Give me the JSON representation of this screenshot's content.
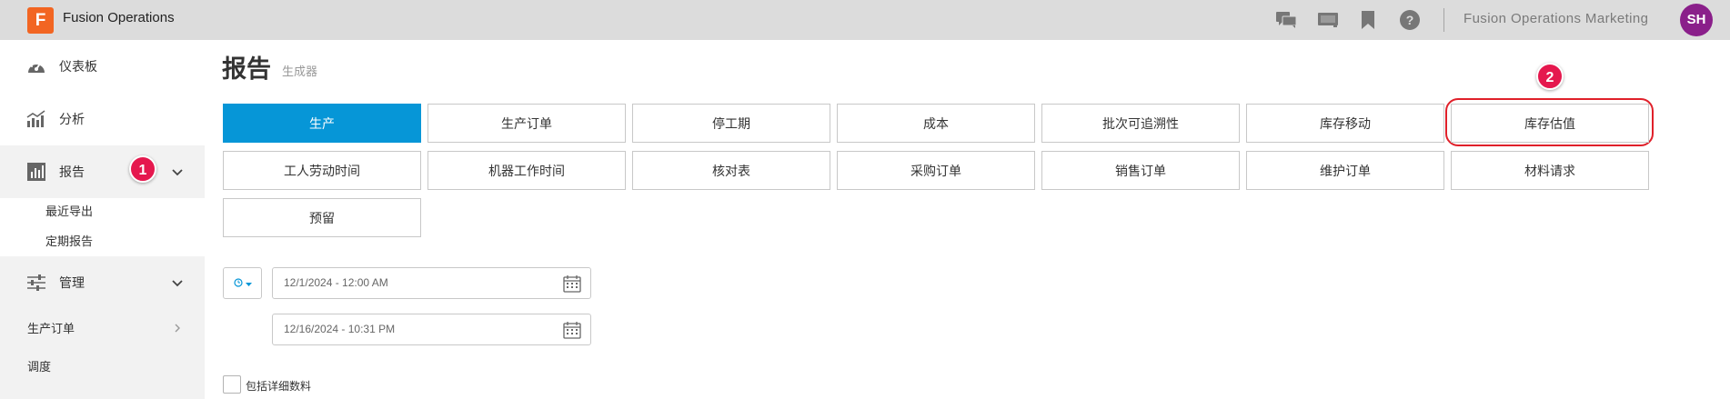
{
  "header": {
    "logo_letter": "F",
    "app_title": "Fusion Operations",
    "org_name": "Fusion Operations Marketing",
    "avatar_initials": "SH",
    "icons": [
      "chat-icon",
      "monitor-icon",
      "bookmark-icon",
      "help-icon"
    ]
  },
  "sidebar": {
    "dashboard": "仪表板",
    "analytics": "分析",
    "reports": "报告",
    "reports_sub": [
      "最近导出",
      "定期报告"
    ],
    "manage": "管理",
    "production_orders": "生产订单",
    "scheduling": "调度"
  },
  "callouts": [
    "1",
    "2"
  ],
  "page": {
    "title": "报告",
    "subtitle": "生成器"
  },
  "report_buttons": [
    "生产",
    "生产订单",
    "停工期",
    "成本",
    "批次可追溯性",
    "库存移动",
    "库存估值",
    "工人劳动时间",
    "机器工作时间",
    "核对表",
    "采购订单",
    "销售订单",
    "维护订单",
    "材料请求",
    "预留"
  ],
  "active_report": "生产",
  "highlighted_report": "库存估值",
  "date_range": {
    "mode_icon": "clock-icon",
    "start": "12/1/2024 - 12:00 AM",
    "end": "12/16/2024 - 10:31 PM"
  },
  "include_details_label": "包括详细数料",
  "colors": {
    "accent": "#0696d7",
    "brand": "#f26522",
    "callout": "#e5184e",
    "avatar": "#8a1f8a",
    "topbar": "#dcdcdc"
  }
}
